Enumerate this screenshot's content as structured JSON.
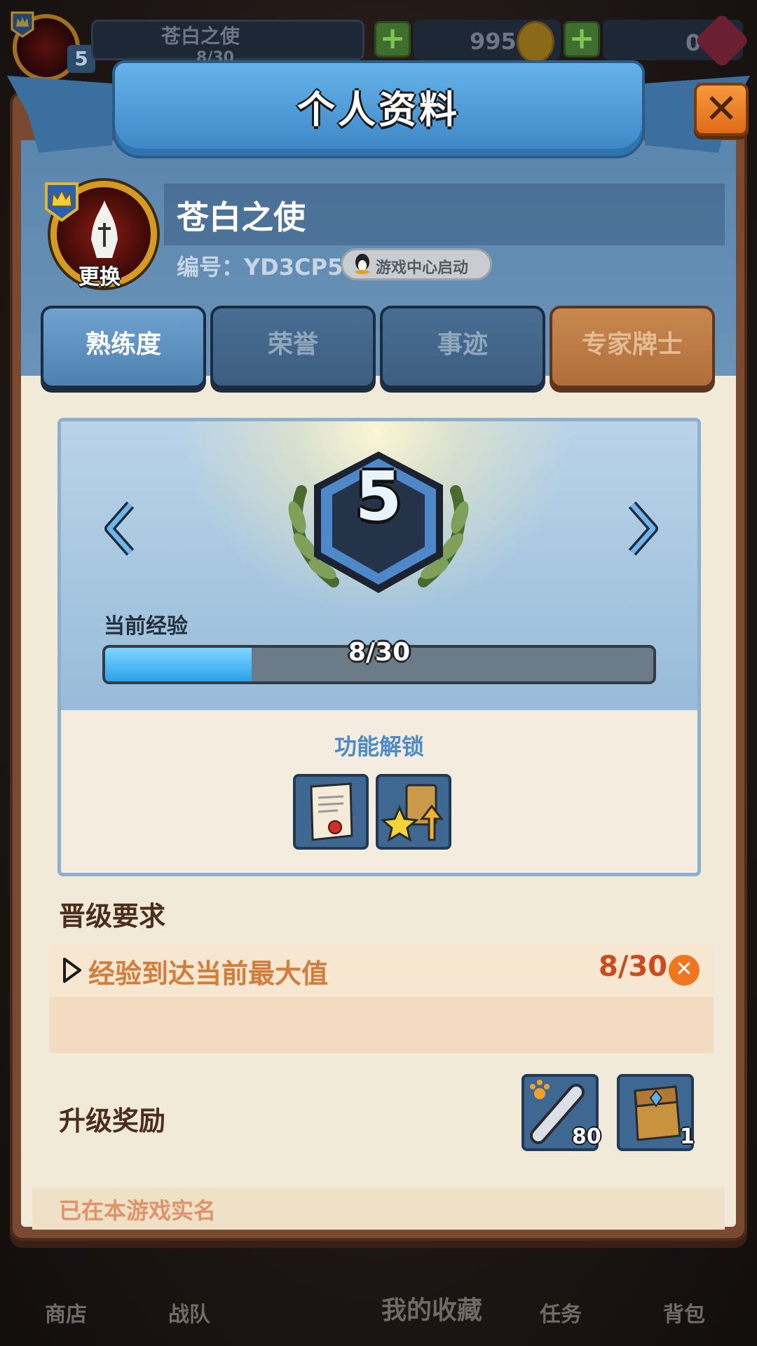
{
  "hud": {
    "player_name": "苍白之使",
    "level": "5",
    "exp_progress": "8/30",
    "coins": "995",
    "gems": "0"
  },
  "bottom_nav": {
    "items": [
      {
        "label": "商店"
      },
      {
        "label": "战队"
      },
      {
        "label": "我的收藏"
      },
      {
        "label": "任务"
      },
      {
        "label": "背包"
      }
    ]
  },
  "dialog": {
    "title": "个人资料",
    "close_icon": "close-icon"
  },
  "profile": {
    "name": "苍白之使",
    "id_text": "编号：YD3CP5",
    "game_center_label": "游戏中心启动",
    "avatar_change_label": "更换"
  },
  "tabs": [
    {
      "label": "熟练度",
      "active": true
    },
    {
      "label": "荣誉",
      "active": false
    },
    {
      "label": "事迹",
      "active": false
    },
    {
      "label": "专家牌士",
      "active": false
    }
  ],
  "level_card": {
    "level": "5",
    "exp_label": "当前经验",
    "exp_current": 8,
    "exp_max": 30,
    "exp_text": "8/30",
    "unlock_title": "功能解锁",
    "unlock_items": [
      "scroll-icon",
      "star-upgrade-icon"
    ]
  },
  "requirements": {
    "title": "晋级要求",
    "items": [
      {
        "text": "经验到达当前最大值",
        "progress": "8/30",
        "met": false
      }
    ]
  },
  "rewards": {
    "title": "升级奖励",
    "items": [
      {
        "icon": "paw-scroll-icon",
        "count": "80"
      },
      {
        "icon": "card-pack-icon",
        "count": "1"
      }
    ]
  },
  "footer": {
    "realname_text": "已在本游戏实名"
  },
  "colors": {
    "accent_blue": "#4d8cc9",
    "requirement_orange": "#d27d3c",
    "requirement_red": "#cc4a1c",
    "close_orange": "#e06b18"
  }
}
